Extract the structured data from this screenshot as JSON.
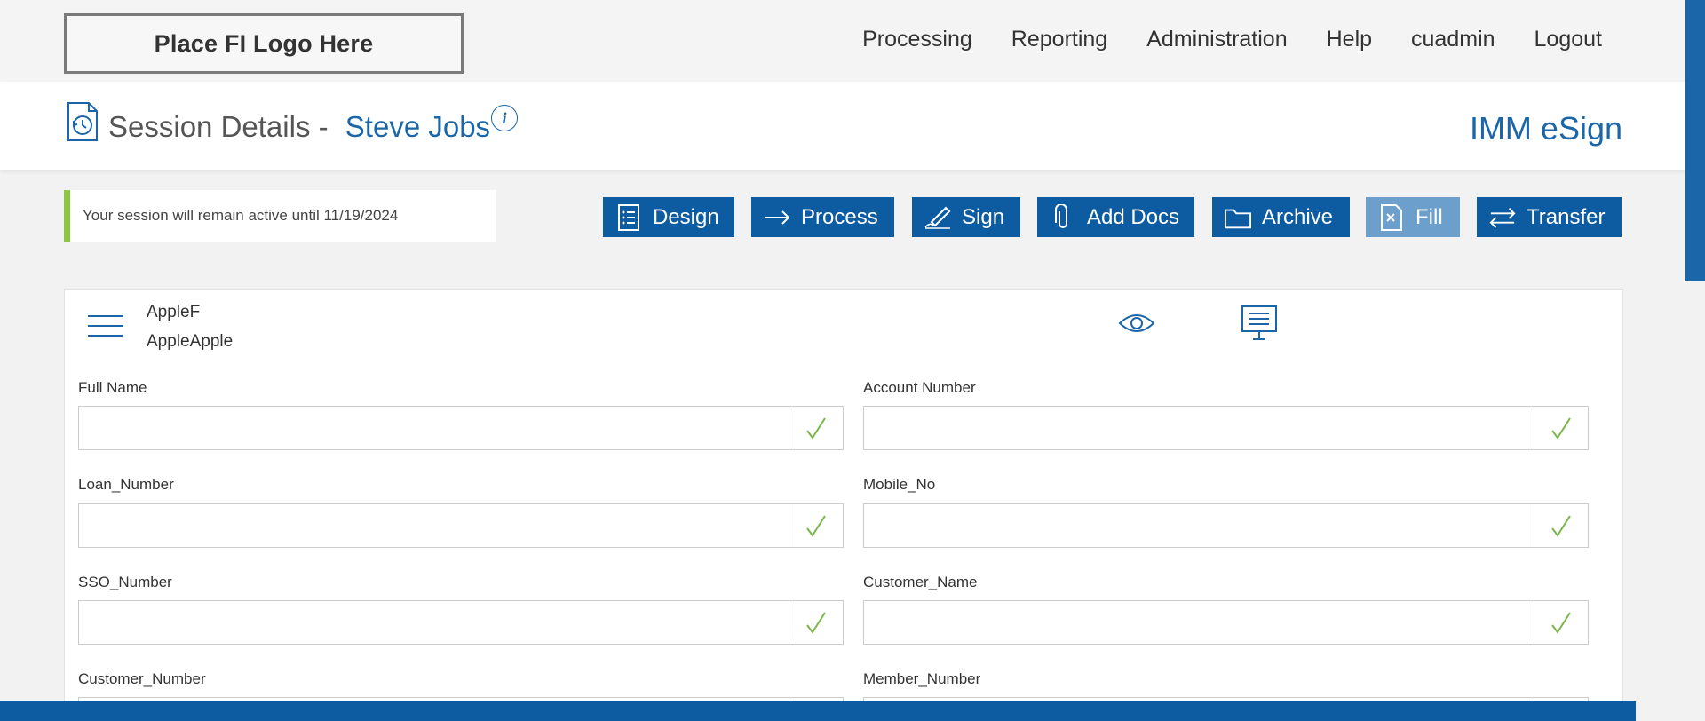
{
  "header": {
    "logo_text": "Place FI Logo Here",
    "nav": [
      "Processing",
      "Reporting",
      "Administration",
      "Help",
      "cuadmin",
      "Logout"
    ]
  },
  "titlebar": {
    "title_prefix": "Session Details -",
    "customer_name": "Steve Jobs",
    "info_glyph": "i",
    "product_name": "IMM eSign"
  },
  "notice": {
    "text": "Your session will remain active until 11/19/2024"
  },
  "toolbar": {
    "buttons": [
      {
        "label": "Design",
        "icon": "checklist-icon"
      },
      {
        "label": "Process",
        "icon": "arrow-right-icon"
      },
      {
        "label": "Sign",
        "icon": "pen-icon"
      },
      {
        "label": "Add Docs",
        "icon": "paperclip-icon"
      },
      {
        "label": "Archive",
        "icon": "folder-icon"
      },
      {
        "label": "Fill",
        "icon": "form-fill-icon",
        "disabled": true
      },
      {
        "label": "Transfer",
        "icon": "transfer-arrows-icon"
      }
    ]
  },
  "document": {
    "name_line1": "AppleF",
    "name_line2": "AppleApple"
  },
  "fields": [
    {
      "label": "Full Name",
      "value": "",
      "placeholder": ""
    },
    {
      "label": "Account Number",
      "value": "",
      "placeholder": ""
    },
    {
      "label": "Loan_Number",
      "value": "",
      "placeholder": ""
    },
    {
      "label": "Mobile_No",
      "value": "",
      "placeholder": ""
    },
    {
      "label": "SSO_Number",
      "value": "",
      "placeholder": ""
    },
    {
      "label": "Customer_Name",
      "value": "",
      "placeholder": ""
    },
    {
      "label": "Customer_Number",
      "value": "",
      "placeholder": ""
    },
    {
      "label": "Member_Number",
      "value": "",
      "placeholder": ""
    }
  ],
  "colors": {
    "accent": "#1a66a8",
    "button": "#0d5ba0",
    "button_disabled": "#6d9fcd",
    "notice_bar": "#8cc63f",
    "check": "#7ab648"
  }
}
